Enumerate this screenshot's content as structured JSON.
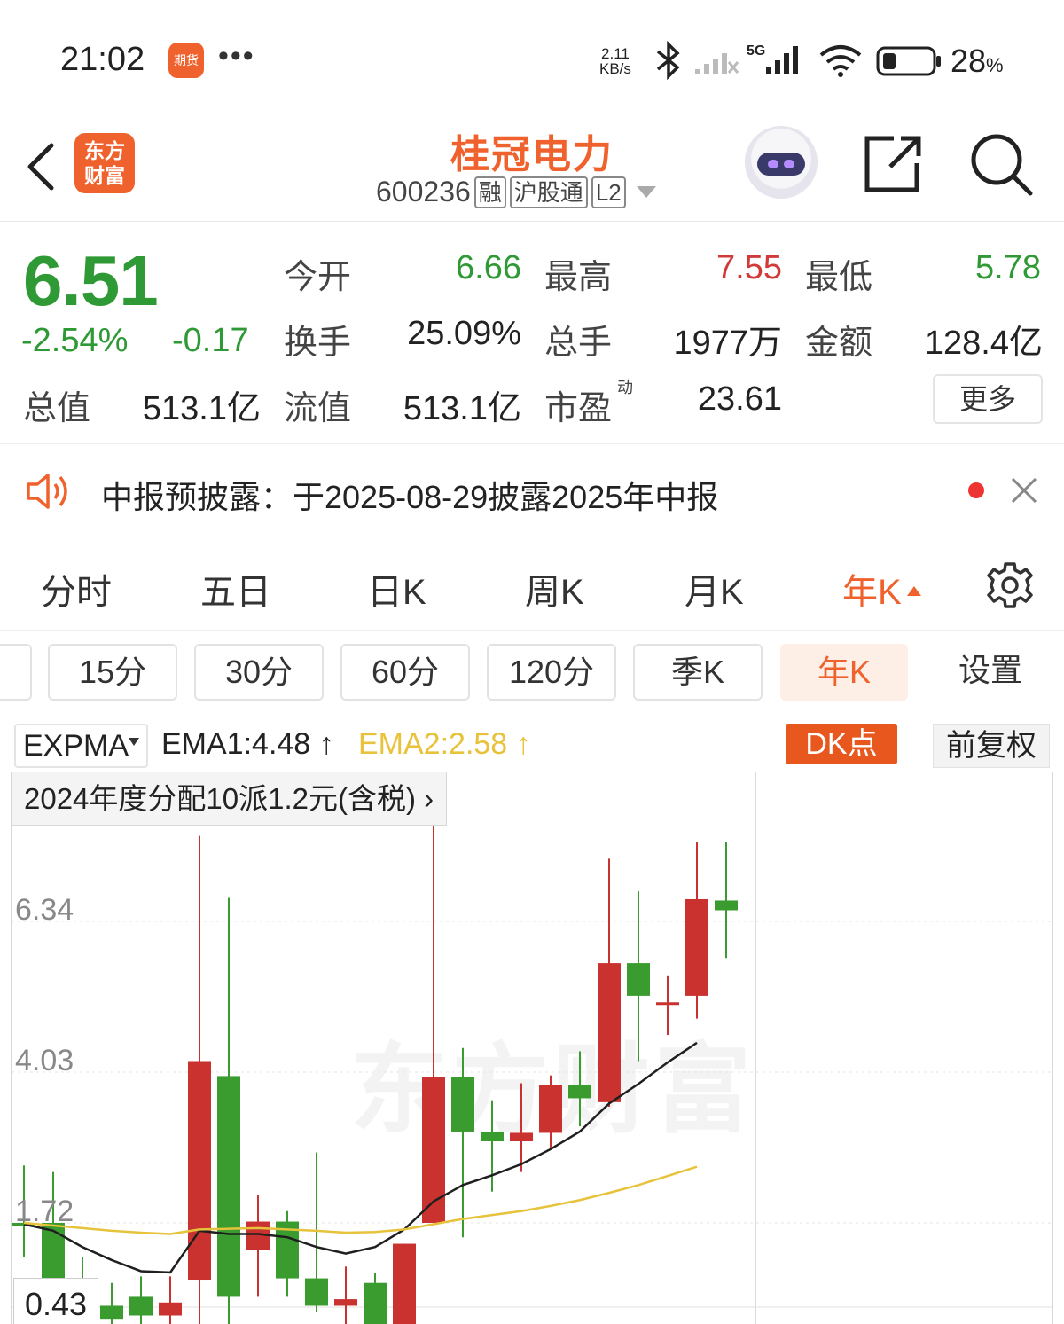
{
  "status_bar": {
    "time": "21:02",
    "app_icon_label": "期货",
    "more": "•••",
    "net_speed_value": "2.11",
    "net_speed_unit": "KB/s",
    "network": "5G",
    "battery_value": "28",
    "battery_unit": "%"
  },
  "header": {
    "logo_line1": "东方",
    "logo_line2": "财富",
    "stock_name": "桂冠电力",
    "stock_code": "600236",
    "tags": [
      "融",
      "沪股通",
      "L2"
    ]
  },
  "quote": {
    "price": "6.51",
    "change_pct": "-2.54%",
    "change_abs": "-0.17",
    "open_label": "今开",
    "open": "6.66",
    "high_label": "最高",
    "high": "7.55",
    "low_label": "最低",
    "low": "5.78",
    "turnover_label": "换手",
    "turnover": "25.09%",
    "volume_label": "总手",
    "volume": "1977万",
    "amount_label": "金额",
    "amount": "128.4亿",
    "total_cap_label": "总值",
    "total_cap": "513.1亿",
    "float_cap_label": "流值",
    "float_cap": "513.1亿",
    "pe_label": "市盈",
    "pe_sup": "动",
    "pe": "23.61",
    "more_label": "更多"
  },
  "notice": {
    "text": "中报预披露：于2025-08-29披露2025年中报"
  },
  "tabs": [
    {
      "label": "分时"
    },
    {
      "label": "五日"
    },
    {
      "label": "日K"
    },
    {
      "label": "周K"
    },
    {
      "label": "月K"
    },
    {
      "label": "年K",
      "active": true
    }
  ],
  "periods": [
    {
      "label": ""
    },
    {
      "label": "15分"
    },
    {
      "label": "30分"
    },
    {
      "label": "60分"
    },
    {
      "label": "120分"
    },
    {
      "label": "季K"
    },
    {
      "label": "年K",
      "active": true
    },
    {
      "label": "设置"
    }
  ],
  "indicator": {
    "name": "EXPMA",
    "ema1": "EMA1:4.48",
    "ema2": "EMA2:2.58",
    "arrow": "↑",
    "dk_label": "DK点",
    "adjust_label": "前复权"
  },
  "chart": {
    "dividend_note": "2024年度分配10派1.2元(含税)",
    "watermark": "东方财富",
    "y_labels": [
      "6.34",
      "4.03",
      "1.72"
    ],
    "low_price_label": "0.43",
    "colors": {
      "up": "#c9322f",
      "down": "#3a9b2f",
      "ema1": "#1f1f1f",
      "ema2": "#e6c33b"
    }
  },
  "chart_data": {
    "type": "candlestick",
    "y_ticks": [
      6.34,
      4.03,
      1.72
    ],
    "candles": [
      {
        "o": 1.72,
        "h": 2.6,
        "l": 1.2,
        "c": 1.72,
        "dir": "down"
      },
      {
        "o": 1.72,
        "h": 2.5,
        "l": 0.0,
        "c": 0.85,
        "dir": "down"
      },
      {
        "o": 0.5,
        "h": 1.2,
        "l": 0.0,
        "c": 0.3,
        "dir": "down"
      },
      {
        "o": 0.45,
        "h": 0.8,
        "l": 0.0,
        "c": 0.25,
        "dir": "down"
      },
      {
        "o": 0.6,
        "h": 0.9,
        "l": 0.0,
        "c": 0.3,
        "dir": "down"
      },
      {
        "o": 0.3,
        "h": 0.9,
        "l": 0.0,
        "c": 0.5,
        "dir": "up"
      },
      {
        "o": 0.85,
        "h": 7.65,
        "l": 0.0,
        "c": 4.2,
        "dir": "up"
      },
      {
        "o": 3.97,
        "h": 6.7,
        "l": 0.0,
        "c": 0.6,
        "dir": "down"
      },
      {
        "o": 1.3,
        "h": 2.15,
        "l": 0.6,
        "c": 1.74,
        "dir": "up"
      },
      {
        "o": 1.74,
        "h": 1.9,
        "l": 0.6,
        "c": 0.87,
        "dir": "down"
      },
      {
        "o": 0.87,
        "h": 2.8,
        "l": 0.35,
        "c": 0.45,
        "dir": "down"
      },
      {
        "o": 0.45,
        "h": 1.05,
        "l": 0.0,
        "c": 0.55,
        "dir": "up"
      },
      {
        "o": 0.8,
        "h": 0.95,
        "l": 0.0,
        "c": 0.12,
        "dir": "down"
      },
      {
        "o": 0.12,
        "h": 1.4,
        "l": 0.0,
        "c": 1.4,
        "dir": "up"
      },
      {
        "o": 1.72,
        "h": 8.5,
        "l": 1.72,
        "c": 3.95,
        "dir": "up"
      },
      {
        "o": 3.95,
        "h": 4.4,
        "l": 1.5,
        "c": 3.12,
        "dir": "down"
      },
      {
        "o": 3.12,
        "h": 3.6,
        "l": 2.2,
        "c": 2.97,
        "dir": "down"
      },
      {
        "o": 2.97,
        "h": 3.86,
        "l": 2.5,
        "c": 3.1,
        "dir": "up"
      },
      {
        "o": 3.1,
        "h": 3.98,
        "l": 2.85,
        "c": 3.83,
        "dir": "up"
      },
      {
        "o": 3.83,
        "h": 4.35,
        "l": 3.2,
        "c": 3.63,
        "dir": "down"
      },
      {
        "o": 3.57,
        "h": 7.3,
        "l": 3.5,
        "c": 5.7,
        "dir": "up"
      },
      {
        "o": 5.7,
        "h": 6.8,
        "l": 4.2,
        "c": 5.2,
        "dir": "down"
      },
      {
        "o": 5.1,
        "h": 5.5,
        "l": 4.6,
        "c": 5.1,
        "dir": "up"
      },
      {
        "o": 5.2,
        "h": 7.55,
        "l": 4.85,
        "c": 6.68,
        "dir": "up"
      },
      {
        "o": 6.66,
        "h": 7.55,
        "l": 5.78,
        "c": 6.51,
        "dir": "down"
      }
    ],
    "ema1": [
      1.7,
      1.6,
      1.35,
      1.15,
      0.98,
      0.96,
      1.6,
      1.55,
      1.55,
      1.5,
      1.35,
      1.25,
      1.35,
      1.62,
      2.05,
      2.3,
      2.45,
      2.62,
      2.85,
      3.12,
      3.55,
      3.85,
      4.18,
      4.48
    ],
    "ema2": [
      1.72,
      1.68,
      1.64,
      1.6,
      1.57,
      1.55,
      1.62,
      1.63,
      1.64,
      1.62,
      1.6,
      1.57,
      1.58,
      1.62,
      1.7,
      1.78,
      1.84,
      1.9,
      1.98,
      2.07,
      2.18,
      2.3,
      2.44,
      2.58
    ]
  }
}
